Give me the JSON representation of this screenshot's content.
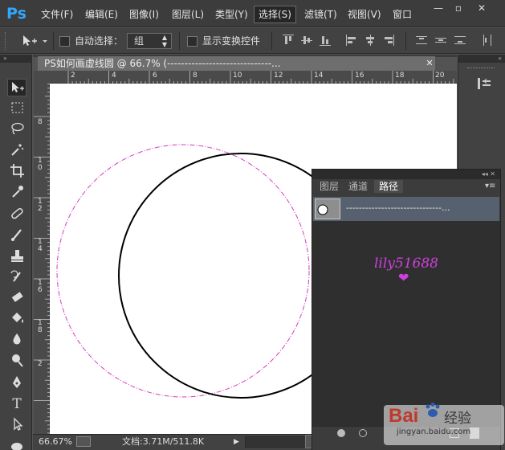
{
  "app": {
    "logo": "Ps"
  },
  "menu": {
    "items": [
      "文件(F)",
      "编辑(E)",
      "图像(I)",
      "图层(L)",
      "类型(Y)",
      "选择(S)",
      "滤镜(T)",
      "视图(V)",
      "窗口"
    ],
    "active_index": 5
  },
  "window_controls": {
    "minimize": "—",
    "restore": "▫",
    "close": "✕"
  },
  "options": {
    "auto_select_label": "自动选择：",
    "auto_select_value": "组",
    "show_transform_label": "显示变换控件"
  },
  "document": {
    "tab_title": "PS如何画虚线圆 @ 66.7% (------------------------------...",
    "ruler_h_ticks": [
      "2",
      "4",
      "6",
      "8",
      "10",
      "12",
      "14",
      "16",
      "18",
      "20"
    ],
    "ruler_v_ticks": [
      "8",
      "1\n0",
      "1\n2",
      "1\n4",
      "1\n6",
      "1\n8",
      "2"
    ]
  },
  "status": {
    "zoom": "66.67%",
    "doc_size": "文档:3.71M/511.8K"
  },
  "panel": {
    "tabs": [
      "图层",
      "通道",
      "路径"
    ],
    "active_tab": 2,
    "path_name": "------------------------------...",
    "watermark": "lily51688",
    "watermark_heart": "❤",
    "brand": "Bai",
    "brand_jingyan": "经验",
    "brand_url": "jingyan.baidu.com"
  },
  "colors": {
    "accent": "#31a8ff",
    "dashed_circle": "#d63cc0",
    "solid_circle": "#000000",
    "watermark": "#d040e0"
  }
}
